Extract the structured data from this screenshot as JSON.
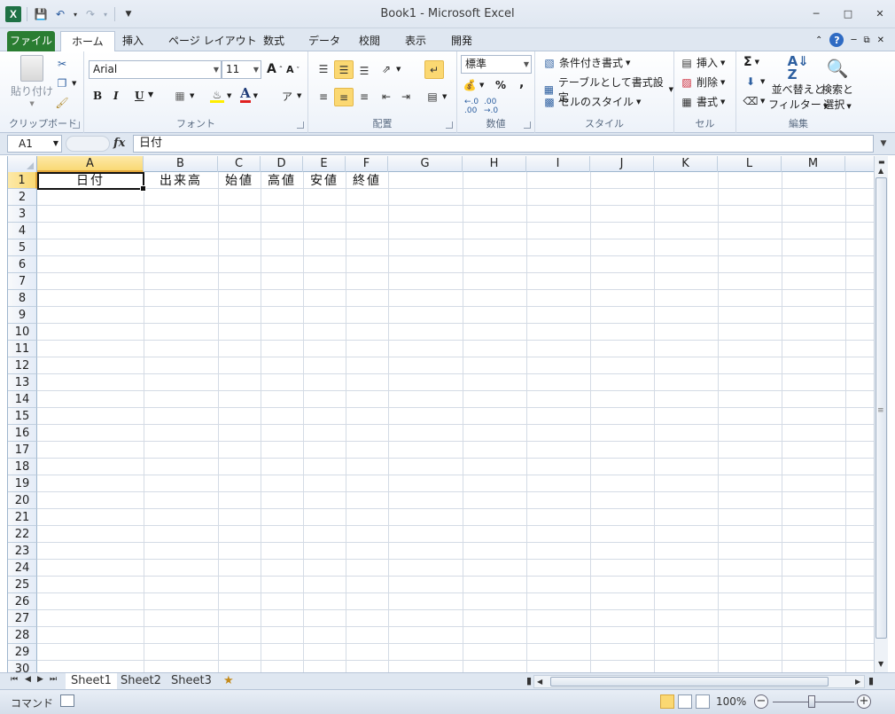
{
  "window": {
    "title": "Book1 - Microsoft Excel"
  },
  "ribbon_tabs": [
    "ファイル",
    "ホーム",
    "挿入",
    "ページ レイアウト",
    "数式",
    "データ",
    "校閲",
    "表示",
    "開発"
  ],
  "clipboard": {
    "paste": "貼り付け",
    "label": "クリップボード"
  },
  "font": {
    "name": "Arial",
    "size": "11",
    "bold": "B",
    "italic": "I",
    "underline": "U",
    "label": "フォント"
  },
  "alignment": {
    "label": "配置"
  },
  "number": {
    "format": "標準",
    "percent": "%",
    "comma": ",",
    "label": "数値"
  },
  "styles": {
    "conditional": "条件付き書式",
    "table": "テーブルとして書式設定",
    "cell": "セルのスタイル",
    "label": "スタイル"
  },
  "cells": {
    "insert": "挿入",
    "delete": "削除",
    "format": "書式",
    "label": "セル"
  },
  "editing": {
    "sum": "Σ",
    "sort1": "並べ替えと",
    "sort2": "フィルター",
    "find1": "検索と",
    "find2": "選択",
    "label": "編集"
  },
  "formula_bar": {
    "name_box": "A1",
    "fx": "fx",
    "content": "日付"
  },
  "columns": [
    "A",
    "B",
    "C",
    "D",
    "E",
    "F",
    "G",
    "H",
    "I",
    "J",
    "K",
    "L",
    "M"
  ],
  "rows": [
    "1",
    "2",
    "3",
    "4",
    "5",
    "6",
    "7",
    "8",
    "9",
    "10",
    "11",
    "12",
    "13",
    "14",
    "15",
    "16",
    "17",
    "18",
    "19",
    "20",
    "21",
    "22",
    "23",
    "24",
    "25",
    "26",
    "27",
    "28",
    "29",
    "30"
  ],
  "cells_row1": [
    "日付",
    "出来高",
    "始値",
    "高値",
    "安値",
    "終値"
  ],
  "sheets": [
    "Sheet1",
    "Sheet2",
    "Sheet3"
  ],
  "status": {
    "mode": "コマンド",
    "zoom": "100%"
  }
}
